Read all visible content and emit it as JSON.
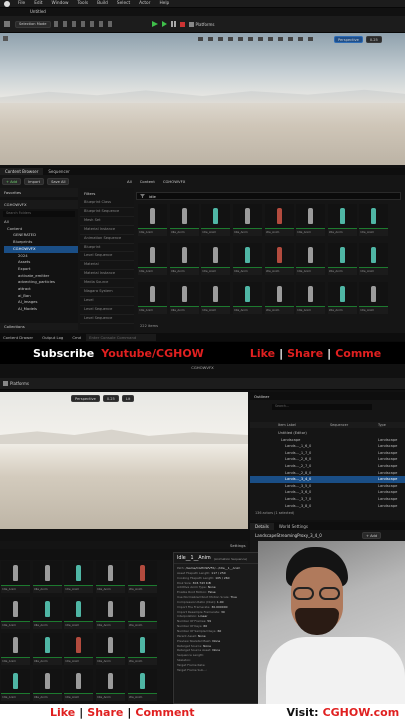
{
  "editor_top": {
    "menu": [
      "File",
      "Edit",
      "Window",
      "Tools",
      "Build",
      "Select",
      "Actor",
      "Help"
    ],
    "tab_title": "Untitled",
    "selection_mode": "Selection Mode",
    "platforms": "Platforms",
    "perspective": "Perspective",
    "lit": "Lit",
    "zoom": "0.25"
  },
  "content_browser": {
    "tabs": [
      "Content Browser",
      "Sequencer"
    ],
    "toolbar": {
      "add": "+ Add",
      "import": "Import",
      "save_all": "Save All"
    },
    "breadcrumb": [
      "All",
      "Content",
      "CGHOWVFX"
    ],
    "search_value": "idle",
    "favorites": "Favorites",
    "project": "CGHOWVFX",
    "search_folders_placeholder": "Search Folders",
    "tree": [
      "All",
      "Content",
      "GENERATED",
      "Blueprints",
      "CGHOWVFX",
      "2024",
      "Assets",
      "Export",
      "activate_emitter",
      "advecting_particles",
      "attract",
      "ai_Ban",
      "AI_Images",
      "AI_Models"
    ],
    "filters_title": "Filters",
    "filters": [
      "Blueprint Class",
      "Blueprint Sequence",
      "Mesh Set",
      "Material Instance",
      "Animation Sequence",
      "Blueprint",
      "Level Sequence",
      "Material",
      "Material Instance",
      "Media Source",
      "Niagara System",
      "Level",
      "Level Sequence",
      "Level Sequence"
    ],
    "item_count": "222 items",
    "collections": "Collections",
    "bottom": {
      "drawer": "Content Drawer",
      "output_log": "Output Log",
      "cmd": "Cmd",
      "console_placeholder": "Enter Console Command"
    }
  },
  "tile_label": "Idle_Anim",
  "banner_top": {
    "subscribe": "Subscribe",
    "channel": "Youtube/CGHOW",
    "like": "Like",
    "share": "Share",
    "comment": "Comme"
  },
  "editor_bottom": {
    "title": "CGHOWVFX",
    "platforms": "Platforms",
    "perspective": "Perspective",
    "lit": "Lit",
    "settings": "Settings",
    "zoom": "0.25"
  },
  "outliner": {
    "title": "Outliner",
    "search_placeholder": "Search...",
    "headers": {
      "item_label": "Item Label",
      "sequencer": "Sequencer",
      "type": "Type"
    },
    "rows": [
      "Untitled (Editor)",
      "Landscape",
      "Lands..._1_6_0",
      "Lands..._1_7_0",
      "Lands..._2_6_0",
      "Lands..._2_7_0",
      "Lands..._2_8_0",
      "Lands..._3_4_0",
      "Lands..._3_5_0",
      "Lands..._3_6_0",
      "Lands..._3_7_0",
      "Lands..._3_8_0"
    ],
    "types": [
      "",
      "Landscape",
      "Landscape",
      "Landscape",
      "Landscape",
      "Landscape",
      "Landscape",
      "Landscape",
      "Landscape",
      "Landscape",
      "Landscape",
      "Landscape"
    ],
    "status": "136 actors (1 selected)"
  },
  "details": {
    "tabs": [
      "Details",
      "World Settings"
    ],
    "object_name": "LandscapeStreamingProxy_3_4_0",
    "add": "+ Add",
    "instance": "(Instance)",
    "edit": "Edit in C++",
    "remaining": "Remaining"
  },
  "tooltip": {
    "title": "Idle__1__Anim",
    "subtitle": "(Animation Sequence)",
    "lines": [
      [
        "Path:",
        "/Game/CGHOWVFX/.../Idle__1__Anim"
      ],
      [
        "Asset Filepath Length:",
        "117 / 250"
      ],
      [
        "Cooking Filepath Length:",
        "105 / 260"
      ],
      [
        "Disk Size:",
        "303.743 KiB"
      ],
      [
        "Additive Anim Type:",
        "None"
      ],
      [
        "Enable Root Motion:",
        "False"
      ],
      [
        "Use Normalized Root Motion Scale:",
        "True"
      ],
      [
        "Compression Ratio (Disk):",
        "1.00"
      ],
      [
        "Import File Framerate:",
        "30.000000"
      ],
      [
        "Import Resample Framerate:",
        "30"
      ],
      [
        "Interpolation:",
        "Linear"
      ],
      [
        "Number Of Frames:",
        "59"
      ],
      [
        "Number Of Keys:",
        "60"
      ],
      [
        "Number Of Sampled Keys:",
        "60"
      ],
      [
        "Parent Asset:",
        "None"
      ],
      [
        "Preview Skeletal Mesh:",
        "None"
      ],
      [
        "Retarget Source:",
        "None"
      ],
      [
        "Retarget Source Asset:",
        "None"
      ],
      [
        "Sequence Length:",
        ""
      ],
      [
        "Skeleton:",
        ""
      ],
      [
        "Target Frame Rate:",
        ""
      ],
      [
        "Target Frame Sub...:",
        ""
      ]
    ]
  },
  "banner_bottom": {
    "like": "Like",
    "share": "Share",
    "comment": "Comment",
    "visit_label": "Visit:",
    "url": "CGHOW.com"
  },
  "colors": {
    "red": "#e02020",
    "white": "#ffffff",
    "accent_green": "#36a852",
    "panel": "#151515",
    "select_blue": "#1a4e86"
  }
}
